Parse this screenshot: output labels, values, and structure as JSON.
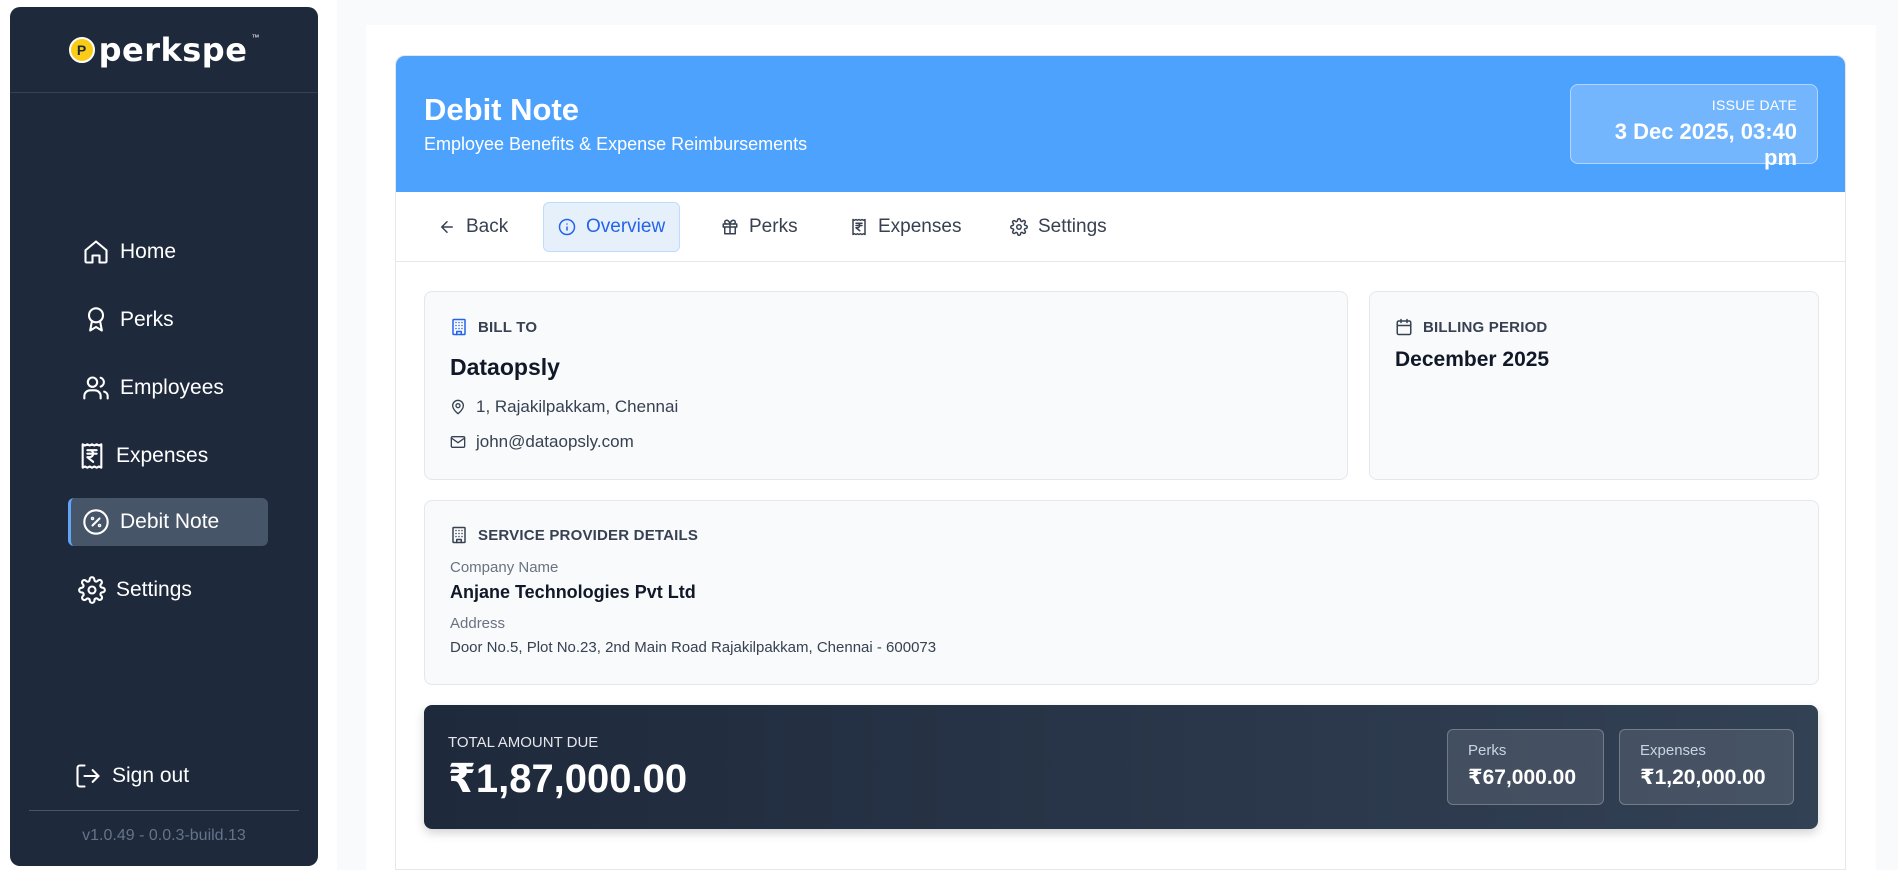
{
  "brand": {
    "badge": "P",
    "name": "perkspe",
    "tm": "™"
  },
  "sidebar": {
    "items": [
      {
        "label": "Home",
        "icon": "home-icon"
      },
      {
        "label": "Perks",
        "icon": "award-icon"
      },
      {
        "label": "Employees",
        "icon": "users-icon"
      },
      {
        "label": "Expenses",
        "icon": "receipt-rupee-icon"
      },
      {
        "label": "Debit Note",
        "icon": "badge-percent-icon",
        "active": true
      },
      {
        "label": "Settings",
        "icon": "gear-icon"
      }
    ],
    "signout": "Sign out",
    "version": "v1.0.49 - 0.0.3-build.13"
  },
  "header": {
    "title": "Debit Note",
    "subtitle": "Employee Benefits & Expense Reimbursements",
    "issue_date_label": "ISSUE DATE",
    "issue_date": "3 Dec 2025, 03:40 pm"
  },
  "tabs": [
    {
      "label": "Back",
      "icon": "arrow-left-icon"
    },
    {
      "label": "Overview",
      "icon": "info-icon",
      "active": true
    },
    {
      "label": "Perks",
      "icon": "gift-icon"
    },
    {
      "label": "Expenses",
      "icon": "receipt-rupee-icon"
    },
    {
      "label": "Settings",
      "icon": "gear-icon"
    }
  ],
  "bill_to": {
    "heading": "BILL TO",
    "name": "Dataopsly",
    "address": "1, Rajakilpakkam, Chennai",
    "email": "john@dataopsly.com"
  },
  "billing_period": {
    "heading": "BILLING PERIOD",
    "value": "December 2025"
  },
  "service_provider": {
    "heading": "SERVICE PROVIDER DETAILS",
    "company_label": "Company Name",
    "company": "Anjane Technologies Pvt Ltd",
    "address_label": "Address",
    "address": "Door No.5, Plot No.23, 2nd Main Road Rajakilpakkam, Chennai - 600073"
  },
  "total": {
    "label": "TOTAL AMOUNT DUE",
    "amount": "₹1,87,000.00",
    "perks_label": "Perks",
    "perks_amount": "₹67,000.00",
    "expenses_label": "Expenses",
    "expenses_amount": "₹1,20,000.00"
  },
  "colors": {
    "sidebar_bg": "#1e293b",
    "header_bg": "#4da2fd",
    "accent": "#2563eb"
  }
}
